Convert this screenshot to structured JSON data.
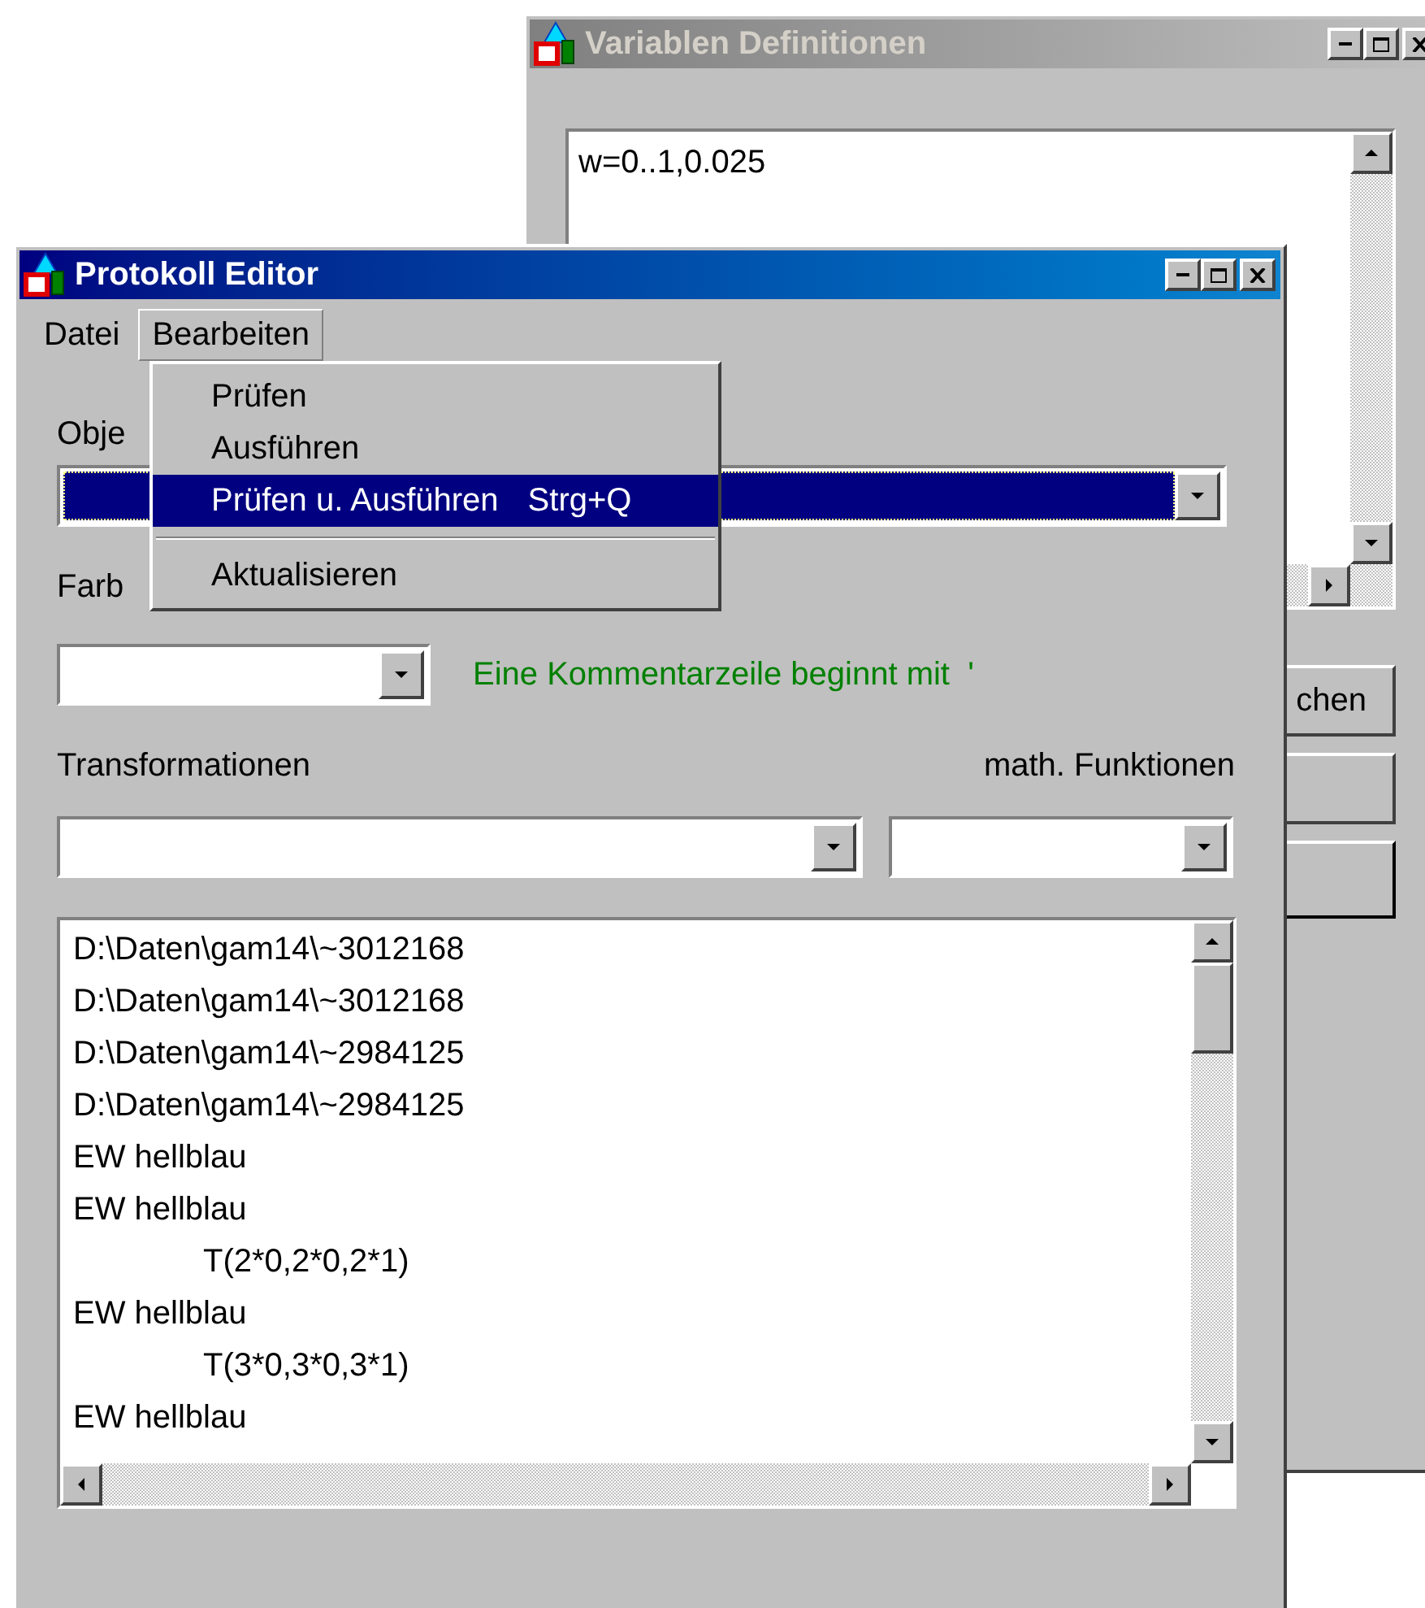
{
  "variables_window": {
    "title": "Variablen Definitionen",
    "active": false,
    "text": "w=0..1,0.025",
    "button_label": "chen"
  },
  "editor_window": {
    "title": "Protokoll Editor",
    "active": true,
    "menu_bar": [
      {
        "label": "Datei",
        "open": false
      },
      {
        "label": "Bearbeiten",
        "open": true
      }
    ],
    "menu": [
      {
        "kind": "item",
        "label": "Prüfen",
        "selected": false
      },
      {
        "kind": "item",
        "label": "Ausführen",
        "selected": false
      },
      {
        "kind": "item",
        "label": "Prüfen u. Ausführen",
        "shortcut": "Strg+Q",
        "selected": true
      },
      {
        "kind": "separator"
      },
      {
        "kind": "item",
        "label": "Aktualisieren",
        "selected": false
      }
    ],
    "objects_label": "Obje",
    "objects_combo": {
      "focused": true
    },
    "color_label": "Farb",
    "comment_hint": "Eine Kommentarzeile beginnt mit  '",
    "transform_label": "Transformationen",
    "math_label": "math. Funktionen",
    "protocol_lines": [
      {
        "text": "D:\\Daten\\gam14\\~3012168"
      },
      {
        "text": "D:\\Daten\\gam14\\~3012168"
      },
      {
        "text": "D:\\Daten\\gam14\\~2984125"
      },
      {
        "text": "D:\\Daten\\gam14\\~2984125"
      },
      {
        "text": "EW hellblau"
      },
      {
        "text": "EW hellblau",
        "children": [
          {
            "text": "T(2*0,2*0,2*1)"
          }
        ]
      },
      {
        "text": "EW hellblau",
        "children": [
          {
            "text": "T(3*0,3*0,3*1)"
          }
        ]
      },
      {
        "text": "EW hellblau"
      }
    ]
  }
}
